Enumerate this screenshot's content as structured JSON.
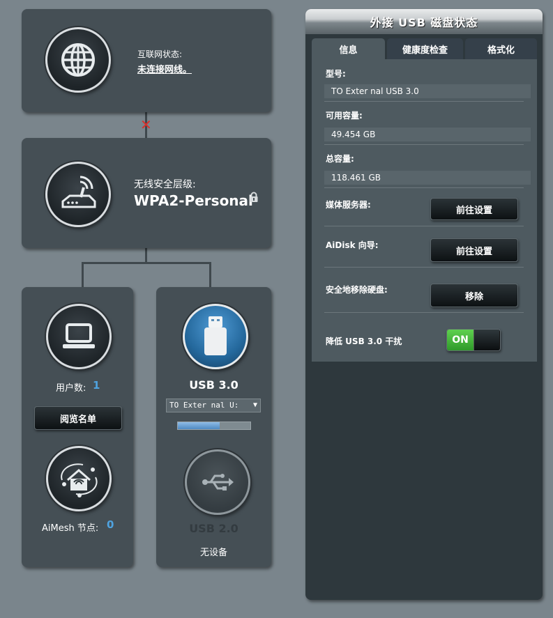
{
  "internet": {
    "status_label": "互联网状态:",
    "status_value": "未连接网线。"
  },
  "disconnect_icon": "x-icon",
  "router": {
    "security_label": "无线安全层级:",
    "security_value": "WPA2-Personal",
    "lock_icon": "lock-icon"
  },
  "clients": {
    "count_label": "用户数:",
    "count_value": "1",
    "browse_button": "阅览名单"
  },
  "aimesh": {
    "label": "AiMesh 节点:",
    "value": "0"
  },
  "usb3": {
    "title": "USB 3.0",
    "device_select": "TO Exter nal U:",
    "usage_fraction": 0.58
  },
  "usb2": {
    "title": "USB 2.0",
    "status": "无设备"
  },
  "usb_panel": {
    "title": "外接 USB 磁盘状态",
    "tabs": [
      "信息",
      "健康度检查",
      "格式化"
    ],
    "model_label": "型号:",
    "model_value": "TO Exter nal USB 3.0",
    "available_label": "可用容量:",
    "available_value": "49.454 GB",
    "total_label": "总容量:",
    "total_value": "118.461 GB",
    "media_server_label": "媒体服务器:",
    "media_server_button": "前往设置",
    "aidisk_label": "AiDisk 向导:",
    "aidisk_button": "前往设置",
    "eject_label": "安全地移除硬盘:",
    "eject_button": "移除",
    "reduce_label": "降低 USB 3.0 干扰",
    "toggle_value": "ON"
  },
  "colors": {
    "accent_blue": "#4fa3e0",
    "toggle_green": "#3fae3a"
  }
}
